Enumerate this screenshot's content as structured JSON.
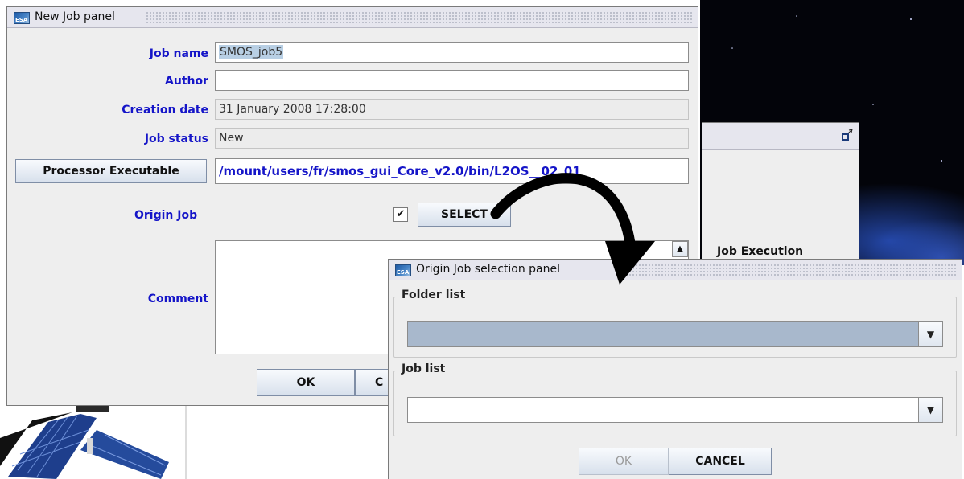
{
  "main_window": {
    "title": "New Job panel",
    "logo_text": "ESA",
    "fields": {
      "job_name": {
        "label": "Job name",
        "value": "SMOS_job5"
      },
      "author": {
        "label": "Author",
        "value": ""
      },
      "creation_date": {
        "label": "Creation date",
        "value": "31 January 2008 17:28:00"
      },
      "job_status": {
        "label": "Job status",
        "value": "New"
      },
      "processor_executable": {
        "button_label": "Processor Executable",
        "value": "/mount/users/fr/smos_gui_Core_v2.0/bin/L2OS__02_01"
      },
      "origin_job": {
        "label": "Origin Job",
        "checked_glyph": "✔",
        "select_label": "SELECT"
      },
      "comment": {
        "label": "Comment",
        "value": ""
      }
    },
    "buttons": {
      "ok": "OK",
      "cancel_partial": "C"
    }
  },
  "background_window": {
    "label_partial": "Job Execution",
    "restore_icon": "restore-icon"
  },
  "origin_panel": {
    "title": "Origin Job selection panel",
    "logo_text": "ESA",
    "folder_group": {
      "title": "Folder list",
      "selected": ""
    },
    "job_group": {
      "title": "Job list",
      "selected": ""
    },
    "buttons": {
      "ok": "OK",
      "cancel": "CANCEL"
    }
  },
  "colors": {
    "label_blue": "#1515c8",
    "processor_path_blue": "#1515c8",
    "folder_combo_selected": "#a8b8cc",
    "arrow": "#000000",
    "space_background": "#03040a"
  }
}
